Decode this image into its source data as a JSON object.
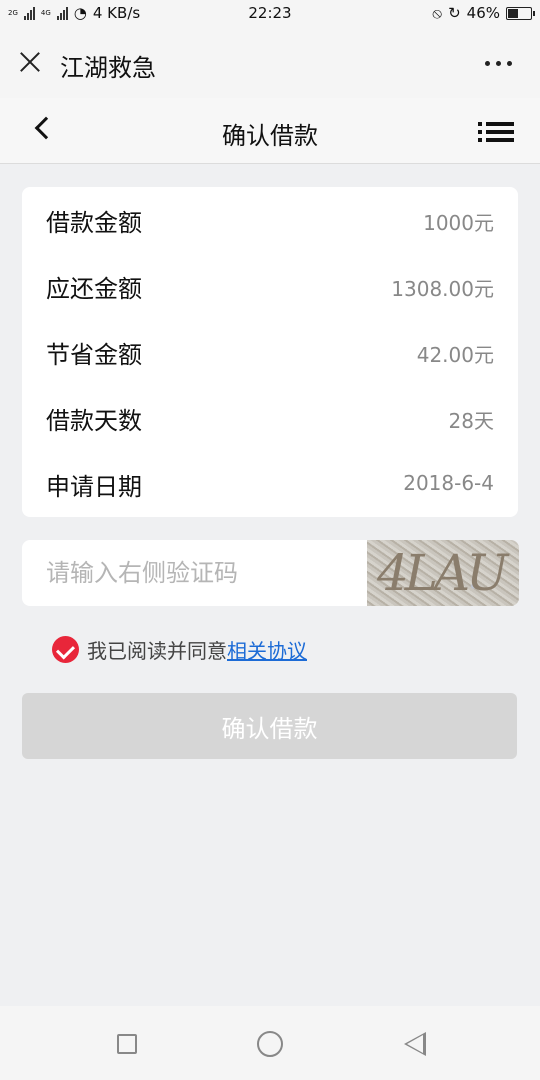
{
  "status_bar": {
    "net_2g": "2G",
    "net_4g": "4G",
    "speed": "4 KB/s",
    "time": "22:23",
    "battery_percent": "46%",
    "battery_level": 0.46
  },
  "app_header": {
    "title": "江湖救急"
  },
  "nav": {
    "title": "确认借款"
  },
  "loan_info": [
    {
      "label": "借款金额",
      "value": "1000元"
    },
    {
      "label": "应还金额",
      "value": "1308.00元"
    },
    {
      "label": "节省金额",
      "value": "42.00元"
    },
    {
      "label": "借款天数",
      "value": "28天"
    },
    {
      "label": "申请日期",
      "value": "2018-6-4"
    }
  ],
  "captcha": {
    "placeholder": "请输入右侧验证码",
    "image_text": "4LAU"
  },
  "agreement": {
    "text": "我已阅读并同意",
    "link": "相关协议",
    "checked": true,
    "check_color": "#e8263a"
  },
  "confirm_button": {
    "label": "确认借款"
  },
  "colors": {
    "background": "#eff0f2",
    "link": "#1c6bd6",
    "button_disabled": "#d6d6d6"
  }
}
